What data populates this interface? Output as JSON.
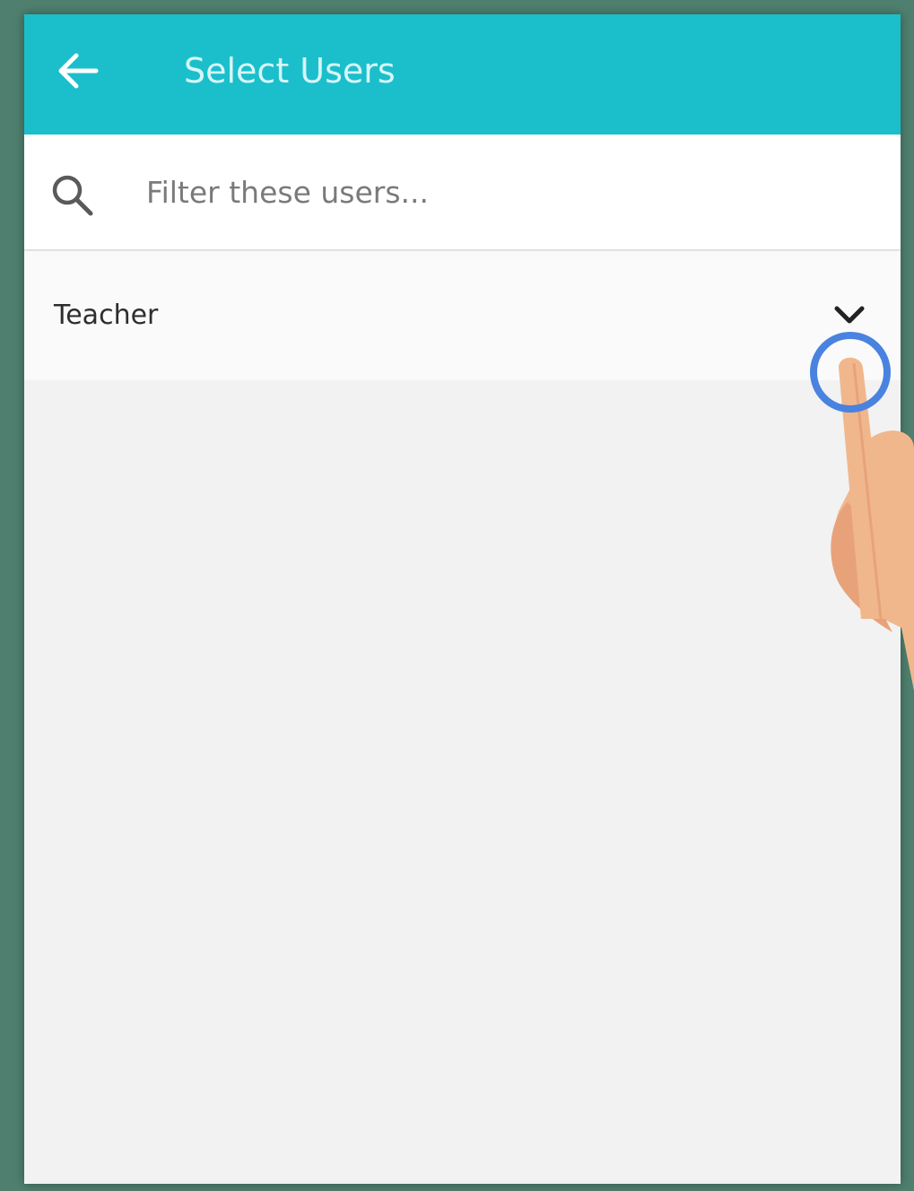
{
  "header": {
    "title": "Select Users",
    "back_icon": "arrow-left-icon"
  },
  "search": {
    "placeholder": "Filter these users...",
    "value": "",
    "icon": "search-icon"
  },
  "groups": [
    {
      "label": "Teacher",
      "icon": "chevron-down-icon",
      "expanded": false
    }
  ],
  "colors": {
    "accent": "#1bbfcb",
    "frame": "#4f7f6e",
    "tap_ring": "#4a82e0",
    "hand": "#f0b78c"
  }
}
